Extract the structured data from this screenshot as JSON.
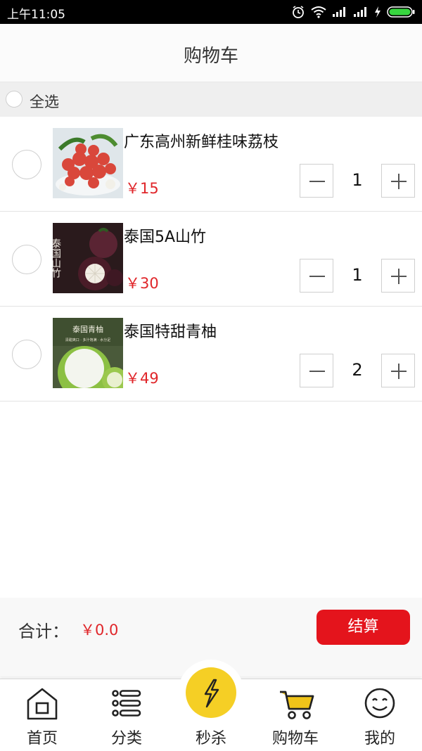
{
  "status_bar": {
    "time": "上午11:05"
  },
  "header": {
    "title": "购物车"
  },
  "select_all": {
    "label": "全选"
  },
  "items": [
    {
      "name": "广东高州新鲜桂味荔枝",
      "price": "￥15",
      "quantity": "1"
    },
    {
      "name": "泰国5A山竹",
      "price": "￥30",
      "quantity": "1"
    },
    {
      "name": "泰国特甜青柚",
      "price": "￥49",
      "quantity": "2"
    }
  ],
  "item_images": {
    "mangosteen_text": "泰国山竹",
    "pomelo_title": "泰国青柚",
    "pomelo_tagline": "清甜爽口 · 多汁饱满 · 水分足"
  },
  "summary": {
    "total_label": "合计：",
    "total_value": "￥0.0",
    "checkout_label": "结算"
  },
  "tabs": [
    {
      "label": "首页",
      "icon": "home-icon"
    },
    {
      "label": "分类",
      "icon": "category-list-icon"
    },
    {
      "label": "秒杀",
      "icon": "lightning-icon"
    },
    {
      "label": "购物车",
      "icon": "cart-icon"
    },
    {
      "label": "我的",
      "icon": "smiley-icon"
    }
  ],
  "colors": {
    "accent_red": "#e4141c",
    "price_red": "#e0262a",
    "flash_yellow": "#f5cf25",
    "cart_yellow": "#f0c419"
  }
}
